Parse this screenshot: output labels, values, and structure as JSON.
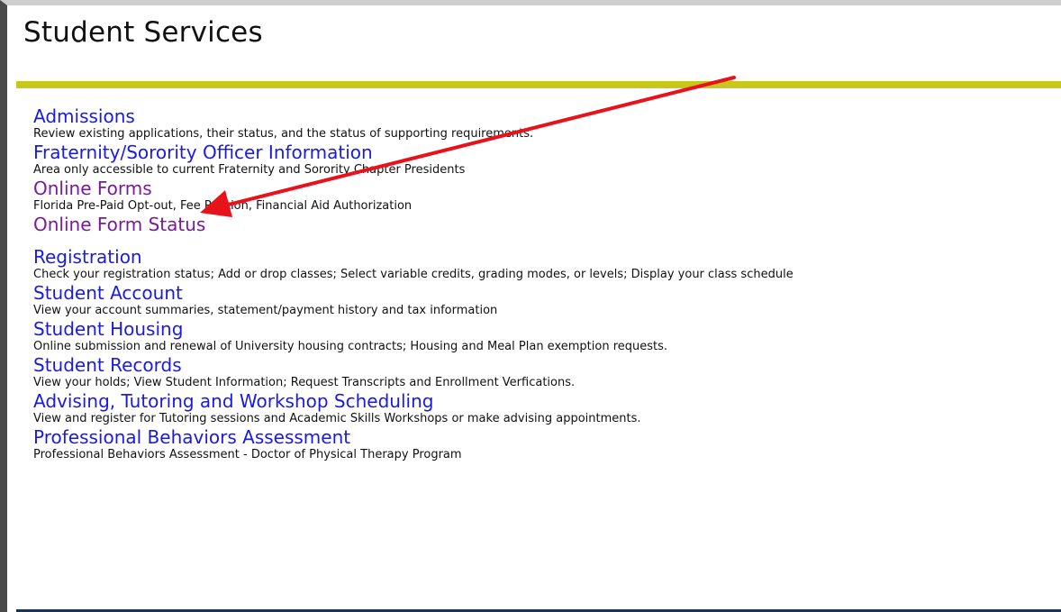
{
  "page": {
    "title": "Student Services"
  },
  "colors": {
    "accent_bar": "#c8c71a",
    "link": "#1a1ae6",
    "visited_link": "#7a1a9a",
    "bottom_bar": "#1c3557",
    "annotation_arrow": "#e8121a"
  },
  "menu": {
    "items": [
      {
        "label": "Admissions",
        "description": "Review existing applications, their status, and the status of supporting requirements.",
        "visited": false
      },
      {
        "label": "Fraternity/Sorority Officer Information",
        "description": "Area only accessible to current Fraternity and Sorority Chapter Presidents",
        "visited": false
      },
      {
        "label": "Online Forms",
        "description": "Florida Pre-Paid Opt-out, Fee Petition, Financial Aid Authorization",
        "visited": true
      },
      {
        "label": "Online Form Status",
        "description": "",
        "visited": true
      },
      {
        "label": "Registration",
        "description": "Check your registration status; Add or drop classes; Select variable credits, grading modes, or levels; Display your class schedule",
        "visited": false
      },
      {
        "label": "Student Account",
        "description": "View your account summaries, statement/payment history and tax information",
        "visited": false
      },
      {
        "label": "Student Housing",
        "description": "Online submission and renewal of University housing contracts; Housing and Meal Plan exemption requests.",
        "visited": false
      },
      {
        "label": "Student Records",
        "description": "View your holds; View Student Information; Request Transcripts and Enrollment Verfications.",
        "visited": false
      },
      {
        "label": "Advising, Tutoring and Workshop Scheduling",
        "description": "View and register for Tutoring sessions and Academic Skills Workshops or make advising appointments.",
        "visited": false
      },
      {
        "label": "Professional Behaviors Assessment",
        "description": "Professional Behaviors Assessment - Doctor of Physical Therapy Program",
        "visited": false
      }
    ]
  },
  "annotation": {
    "icon": "red-arrow-icon",
    "points_to": "Online Forms"
  }
}
